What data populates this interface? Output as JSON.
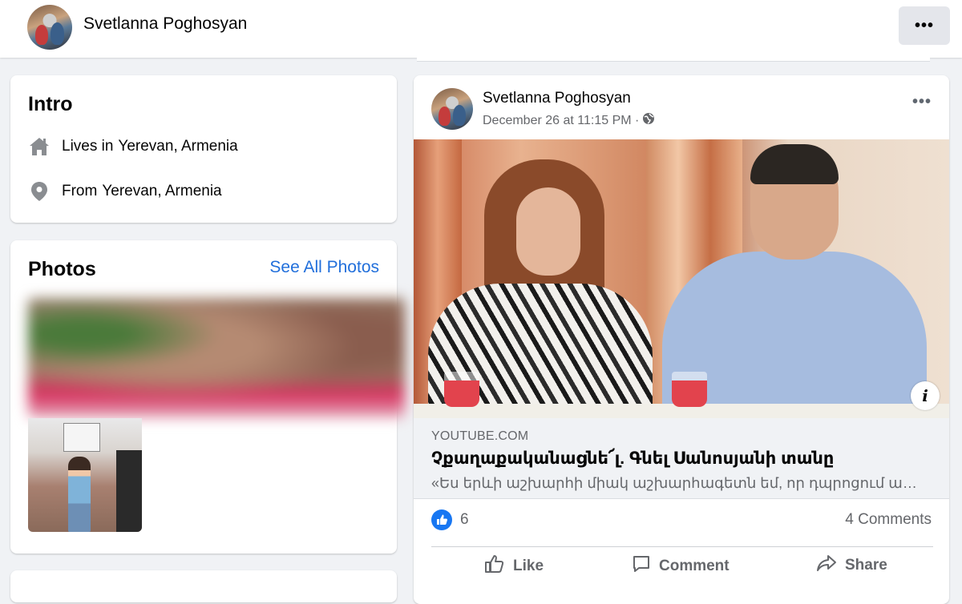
{
  "header": {
    "profile_name": "Svetlanna Poghosyan",
    "more_label": "•••"
  },
  "intro": {
    "title": "Intro",
    "lives_label": "Lives in",
    "lives_value": "Yerevan, Armenia",
    "from_label": "From",
    "from_value": "Yerevan, Armenia"
  },
  "photos": {
    "title": "Photos",
    "see_all": "See All Photos"
  },
  "post": {
    "author": "Svetlanna Poghosyan",
    "timestamp": "December 26 at 11:15 PM ·",
    "more_label": "•••",
    "link": {
      "domain": "YOUTUBE.COM",
      "title": "Չքաղաքականացնե՜լ. Գնել Սանոսյանի տանը",
      "description": "«Ես երևի աշխարհի միակ աշխարհագետն եմ, որ դպրոցում աշ…"
    },
    "reaction_count": "6",
    "comments_count": "4 Comments",
    "actions": {
      "like": "Like",
      "comment": "Comment",
      "share": "Share"
    }
  },
  "colors": {
    "accent": "#1877f2",
    "link_blue": "#216fdb",
    "secondary_text": "#65676b",
    "background": "#f0f2f5"
  }
}
